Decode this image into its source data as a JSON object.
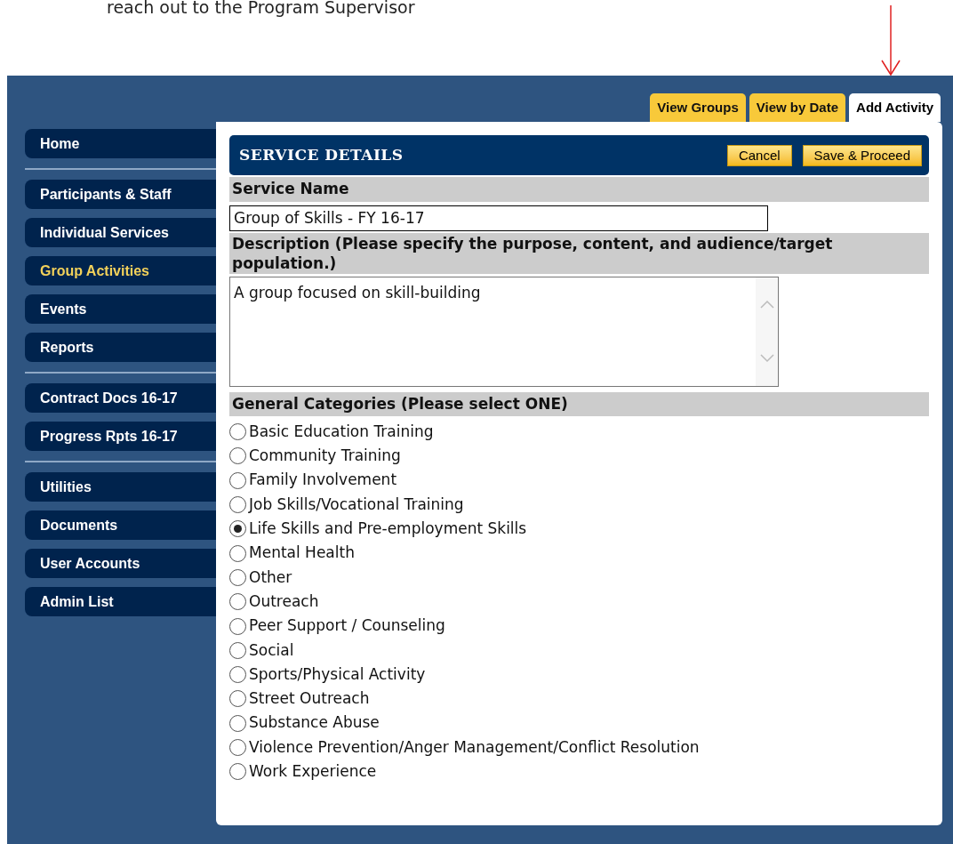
{
  "note": "reach out to the Program Supervisor",
  "tabs": [
    {
      "label": "View Groups",
      "selected": false
    },
    {
      "label": "View by Date",
      "selected": false
    },
    {
      "label": "Add Activity",
      "selected": true
    }
  ],
  "sidebar": {
    "groups": [
      [
        {
          "label": "Home",
          "selected": false
        }
      ],
      [
        {
          "label": "Participants & Staff",
          "selected": false
        },
        {
          "label": "Individual Services",
          "selected": false
        },
        {
          "label": "Group Activities",
          "selected": true
        },
        {
          "label": "Events",
          "selected": false
        },
        {
          "label": "Reports",
          "selected": false
        }
      ],
      [
        {
          "label": "Contract Docs 16-17",
          "selected": false
        },
        {
          "label": "Progress Rpts 16-17",
          "selected": false
        }
      ],
      [
        {
          "label": "Utilities",
          "selected": false
        },
        {
          "label": "Documents",
          "selected": false
        },
        {
          "label": "User Accounts",
          "selected": false
        },
        {
          "label": "Admin List",
          "selected": false
        }
      ]
    ]
  },
  "panel": {
    "title": "SERVICE DETAILS",
    "buttons": [
      "Cancel",
      "Save & Proceed"
    ],
    "service_name": {
      "label": "Service Name",
      "value": "Group of Skills - FY 16-17"
    },
    "description": {
      "label": "Description (Please specify the purpose, content, and audience/target population.)",
      "value": "A group focused on skill-building"
    },
    "categories": {
      "label": "General Categories (Please select ONE)",
      "options": [
        {
          "label": "Basic Education Training",
          "selected": false
        },
        {
          "label": "Community Training",
          "selected": false
        },
        {
          "label": "Family Involvement",
          "selected": false
        },
        {
          "label": "Job Skills/Vocational Training",
          "selected": false
        },
        {
          "label": "Life Skills and Pre-employment Skills",
          "selected": true
        },
        {
          "label": "Mental Health",
          "selected": false
        },
        {
          "label": "Other",
          "selected": false
        },
        {
          "label": "Outreach",
          "selected": false
        },
        {
          "label": "Peer Support / Counseling",
          "selected": false
        },
        {
          "label": "Social",
          "selected": false
        },
        {
          "label": "Sports/Physical Activity",
          "selected": false
        },
        {
          "label": "Street Outreach",
          "selected": false
        },
        {
          "label": "Substance Abuse",
          "selected": false
        },
        {
          "label": "Violence Prevention/Anger Management/Conflict Resolution",
          "selected": false
        },
        {
          "label": "Work Experience",
          "selected": false
        }
      ]
    }
  }
}
